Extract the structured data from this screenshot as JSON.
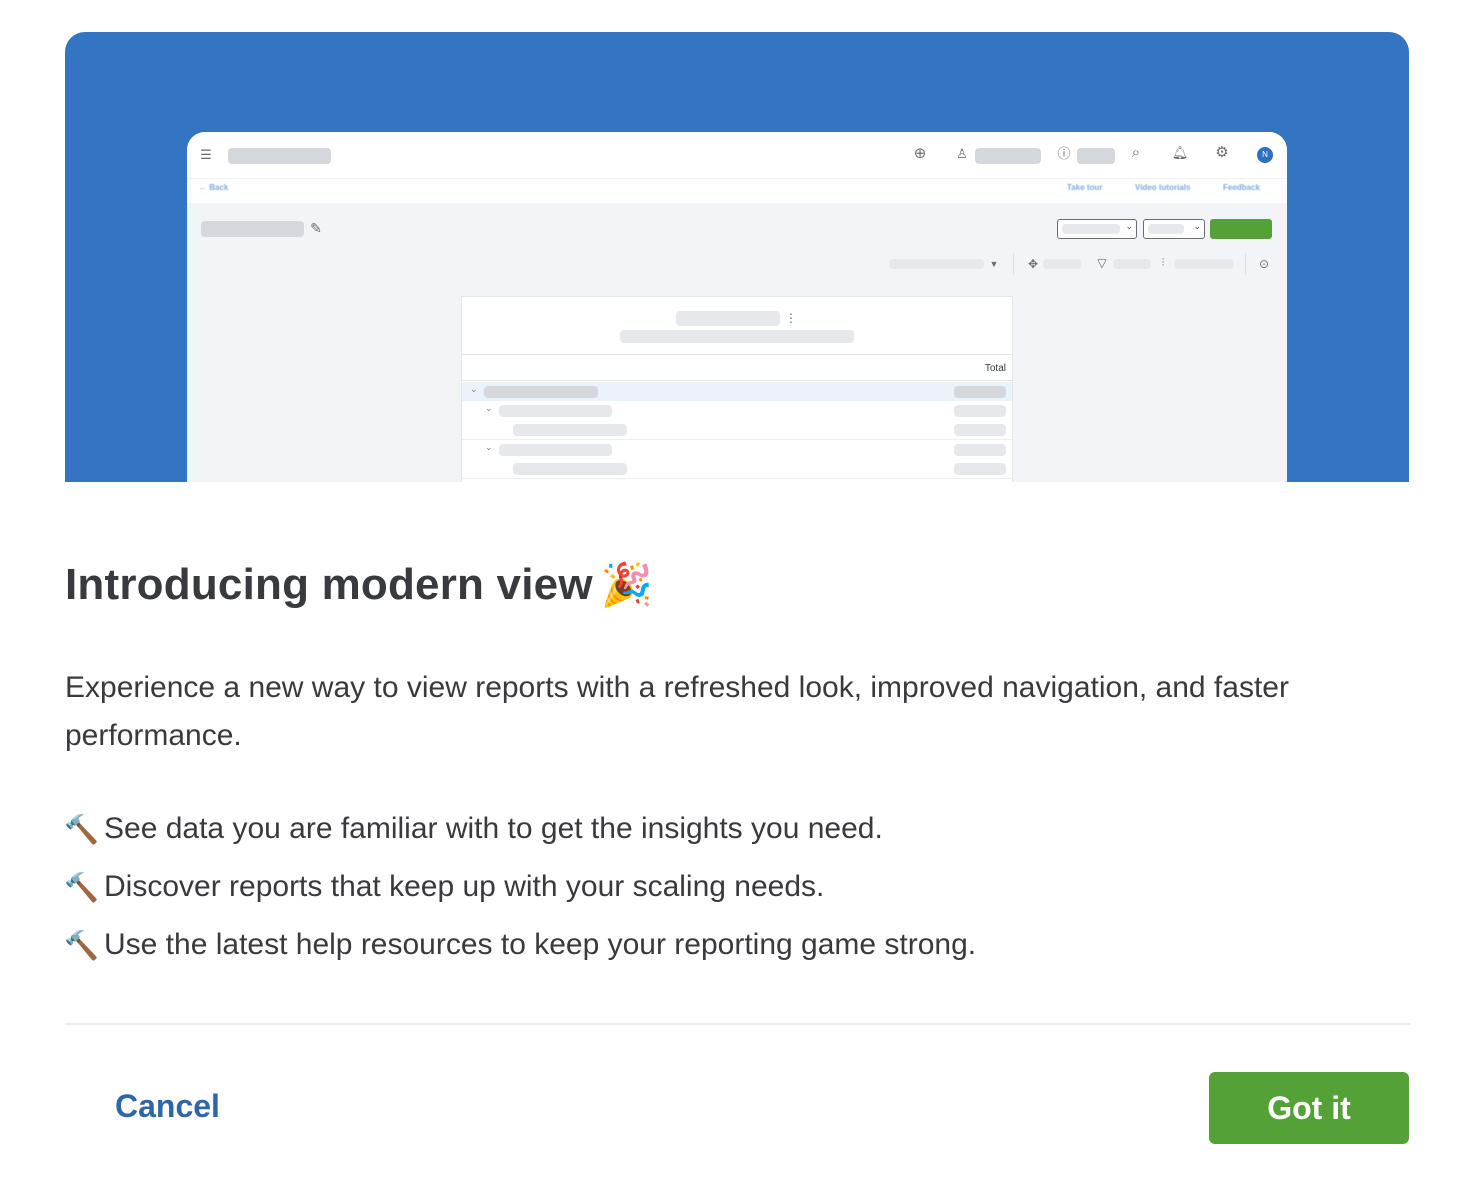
{
  "hero": {
    "background_color": "#3375c0",
    "mock": {
      "back_link": "← Back",
      "links": [
        "Take tour",
        "Video tutorials",
        "Feedback"
      ],
      "avatar_initial": "N",
      "report_column_header": "Total",
      "icons": [
        "menu-collapse-icon",
        "plus-circle-icon",
        "user-icon",
        "help-icon",
        "search-icon",
        "bell-icon",
        "gear-icon",
        "pencil-icon",
        "group-icon",
        "filter-icon",
        "sliders-icon",
        "chevron-circle-icon",
        "more-vertical-icon"
      ]
    }
  },
  "dialog": {
    "title": "Introducing modern view",
    "title_emoji": "🎉",
    "description": "Experience a new way to view reports with a refreshed look, improved navigation, and faster performance.",
    "bullet_icon": "🔨",
    "bullets": [
      "See data you are familiar with to get the insights you need.",
      "Discover reports that keep up with your scaling needs.",
      "Use the latest help resources to keep your reporting game strong."
    ],
    "cancel_label": "Cancel",
    "confirm_label": "Got it"
  },
  "colors": {
    "primary_green": "#53a137",
    "link_blue": "#2d67a8",
    "text": "#393a3d"
  }
}
